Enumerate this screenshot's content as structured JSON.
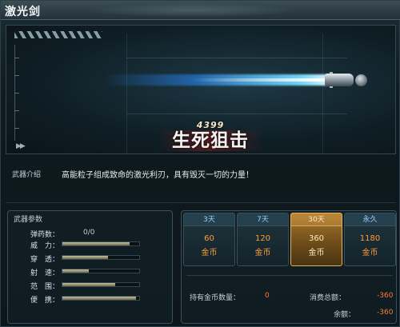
{
  "window": {
    "title": "激光剑"
  },
  "preview": {
    "logo_number": "4399",
    "logo_text": "生死狙击"
  },
  "intro": {
    "label": "武器介绍",
    "text": "高能粒子组成致命的激光利刃，具有毁灭一切的力量！"
  },
  "stats": {
    "title": "武器参数",
    "ammo_label": "弹药数：",
    "ammo_value": "0/0",
    "items": [
      {
        "label": "威　力：",
        "level": 0.87
      },
      {
        "label": "穿　透：",
        "level": 0.59
      },
      {
        "label": "射　速：",
        "level": 0.34
      },
      {
        "label": "范　围：",
        "level": 0.69
      },
      {
        "label": "便　携：",
        "level": 0.96
      }
    ]
  },
  "pricing": {
    "options": [
      {
        "duration": "3天",
        "price": "60",
        "unit": "金币",
        "selected": false
      },
      {
        "duration": "7天",
        "price": "120",
        "unit": "金币",
        "selected": false
      },
      {
        "duration": "30天",
        "price": "360",
        "unit": "金币",
        "selected": true
      },
      {
        "duration": "永久",
        "price": "1180",
        "unit": "金币",
        "selected": false
      }
    ],
    "owned_label": "持有金币数量：",
    "owned_value": "0",
    "total_label": "消费总额：",
    "total_value": "-360",
    "balance_label": "余额：",
    "balance_value": "-360"
  },
  "colors": {
    "accent_orange": "#ff9c3a",
    "selected_gold": "#a8792d",
    "beam_blue": "#40a0ff"
  }
}
